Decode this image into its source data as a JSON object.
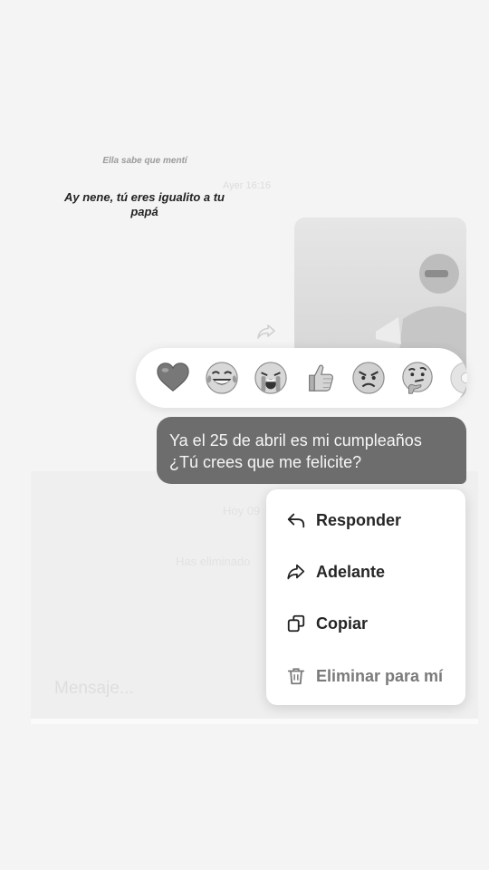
{
  "story": {
    "caption_small": "Ella sabe que mentí",
    "caption_main": "Ay nene, tú eres igualito a tu papá",
    "faint_time": "Ayer 16:16"
  },
  "chat": {
    "message_lines": [
      "Ya el 25 de abril es mi cumpleaños",
      "¿Tú crees que me felicite?"
    ],
    "ghost_date": "Hoy 09",
    "ghost_removed": "Has eliminado"
  },
  "reactions": {
    "items": [
      "heart",
      "tears-of-joy",
      "loudly-crying",
      "thumbs-up",
      "angry",
      "thinking"
    ]
  },
  "composer": {
    "placeholder": "Mensaje..."
  },
  "context_menu": {
    "items": [
      {
        "label": "Responder",
        "icon": "reply-icon"
      },
      {
        "label": "Adelante",
        "icon": "forward-icon"
      },
      {
        "label": "Copiar",
        "icon": "copy-icon"
      },
      {
        "label": "Eliminar para mí",
        "icon": "trash-icon"
      }
    ]
  }
}
